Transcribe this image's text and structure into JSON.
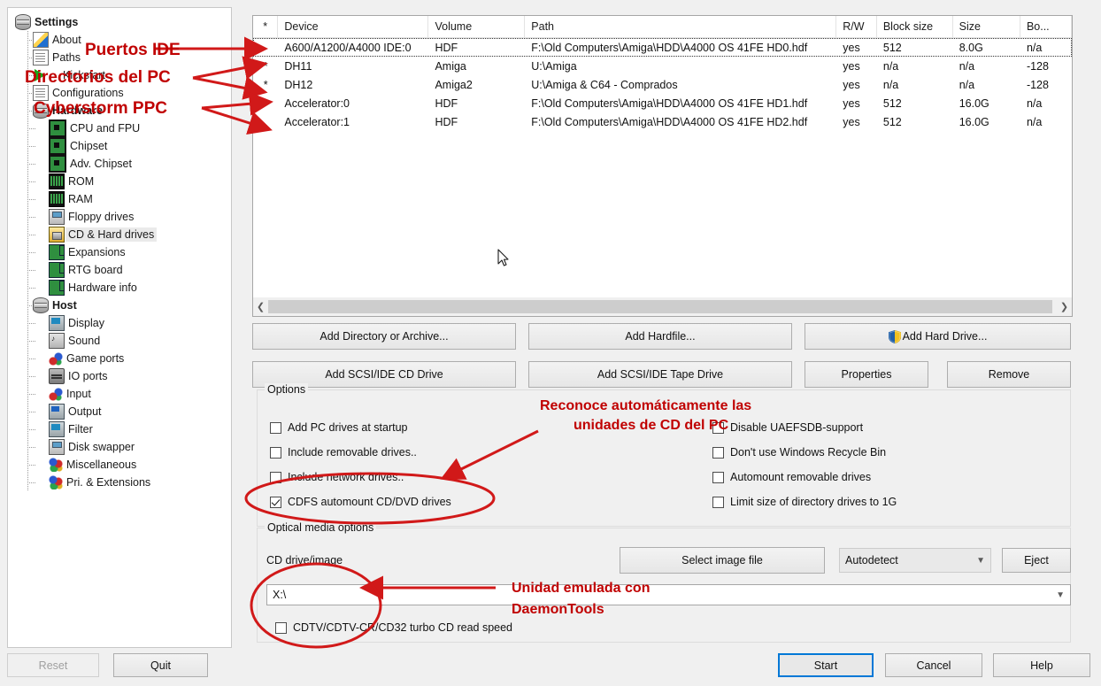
{
  "window": {
    "title": "Settings"
  },
  "sidebar": {
    "items": [
      {
        "label": "Settings",
        "icon": "stack-icon",
        "level": 0,
        "bold": true,
        "selected": false
      },
      {
        "label": "About",
        "icon": "pen-icon",
        "level": 1,
        "bold": false,
        "selected": false
      },
      {
        "label": "Paths",
        "icon": "doc-icon",
        "level": 1,
        "bold": false,
        "selected": false
      },
      {
        "label": "Kickstart",
        "icon": "play-icon",
        "level": 1,
        "bold": false,
        "selected": false
      },
      {
        "label": "Configurations",
        "icon": "doc-icon",
        "level": 1,
        "bold": false,
        "selected": false
      },
      {
        "label": "Hardware",
        "icon": "stack-icon",
        "level": 1,
        "bold": true,
        "selected": false
      },
      {
        "label": "CPU and FPU",
        "icon": "chip-icon",
        "level": 2,
        "bold": false,
        "selected": false
      },
      {
        "label": "Chipset",
        "icon": "chip-icon",
        "level": 2,
        "bold": false,
        "selected": false
      },
      {
        "label": "Adv. Chipset",
        "icon": "chip-icon",
        "level": 2,
        "bold": false,
        "selected": false
      },
      {
        "label": "ROM",
        "icon": "ram-icon",
        "level": 2,
        "bold": false,
        "selected": false
      },
      {
        "label": "RAM",
        "icon": "ram-icon",
        "level": 2,
        "bold": false,
        "selected": false
      },
      {
        "label": "Floppy drives",
        "icon": "floppy-icon",
        "level": 2,
        "bold": false,
        "selected": false
      },
      {
        "label": "CD & Hard drives",
        "icon": "cd-hdd-icon",
        "level": 2,
        "bold": false,
        "selected": true
      },
      {
        "label": "Expansions",
        "icon": "exp-card-icon",
        "level": 2,
        "bold": false,
        "selected": false
      },
      {
        "label": "RTG board",
        "icon": "exp-card-icon",
        "level": 2,
        "bold": false,
        "selected": false
      },
      {
        "label": "Hardware info",
        "icon": "exp-card-icon",
        "level": 2,
        "bold": false,
        "selected": false
      },
      {
        "label": "Host",
        "icon": "stack-icon",
        "level": 1,
        "bold": true,
        "selected": false
      },
      {
        "label": "Display",
        "icon": "monitor-icon",
        "level": 2,
        "bold": false,
        "selected": false
      },
      {
        "label": "Sound",
        "icon": "sound-icon",
        "level": 2,
        "bold": false,
        "selected": false
      },
      {
        "label": "Game ports",
        "icon": "joystick-icon",
        "level": 2,
        "bold": false,
        "selected": false
      },
      {
        "label": "IO ports",
        "icon": "io-icon",
        "level": 2,
        "bold": false,
        "selected": false
      },
      {
        "label": "Input",
        "icon": "joystick-icon",
        "level": 2,
        "bold": false,
        "selected": false
      },
      {
        "label": "Output",
        "icon": "output-icon",
        "level": 2,
        "bold": false,
        "selected": false
      },
      {
        "label": "Filter",
        "icon": "monitor-icon",
        "level": 2,
        "bold": false,
        "selected": false
      },
      {
        "label": "Disk swapper",
        "icon": "floppy-icon",
        "level": 2,
        "bold": false,
        "selected": false
      },
      {
        "label": "Miscellaneous",
        "icon": "balls-icon",
        "level": 2,
        "bold": false,
        "selected": false
      },
      {
        "label": "Pri. & Extensions",
        "icon": "balls-icon",
        "level": 2,
        "bold": false,
        "selected": false
      }
    ]
  },
  "drive_table": {
    "columns": [
      "*",
      "Device",
      "Volume",
      "Path",
      "R/W",
      "Block size",
      "Size",
      "Bo..."
    ],
    "rows": [
      {
        "star": "",
        "device": "A600/A1200/A4000 IDE:0",
        "volume": "HDF",
        "path": "F:\\Old Computers\\Amiga\\HDD\\A4000 OS 41FE HD0.hdf",
        "rw": "yes",
        "block": "512",
        "size": "8.0G",
        "bo": "n/a",
        "focused": true
      },
      {
        "star": "*",
        "device": "DH11",
        "volume": "Amiga",
        "path": "U:\\Amiga",
        "rw": "yes",
        "block": "n/a",
        "size": "n/a",
        "bo": "-128",
        "focused": false
      },
      {
        "star": "*",
        "device": "DH12",
        "volume": "Amiga2",
        "path": "U:\\Amiga & C64 - Comprados",
        "rw": "yes",
        "block": "n/a",
        "size": "n/a",
        "bo": "-128",
        "focused": false
      },
      {
        "star": "",
        "device": "Accelerator:0",
        "volume": "HDF",
        "path": "F:\\Old Computers\\Amiga\\HDD\\A4000 OS 41FE HD1.hdf",
        "rw": "yes",
        "block": "512",
        "size": "16.0G",
        "bo": "n/a",
        "focused": false
      },
      {
        "star": "",
        "device": "Accelerator:1",
        "volume": "HDF",
        "path": "F:\\Old Computers\\Amiga\\HDD\\A4000 OS 41FE HD2.hdf",
        "rw": "yes",
        "block": "512",
        "size": "16.0G",
        "bo": "n/a",
        "focused": false
      }
    ]
  },
  "action_buttons": {
    "add_directory": "Add Directory or Archive...",
    "add_hardfile": "Add Hardfile...",
    "add_hard_drive": "Add Hard Drive...",
    "add_cd_drive": "Add SCSI/IDE CD Drive",
    "add_tape_drive": "Add SCSI/IDE Tape Drive",
    "properties": "Properties",
    "remove": "Remove"
  },
  "options": {
    "title": "Options",
    "left": [
      {
        "label": "Add PC drives at startup",
        "checked": false
      },
      {
        "label": "Include removable drives..",
        "checked": false
      },
      {
        "label": "Include network drives..",
        "checked": false
      },
      {
        "label": "CDFS automount CD/DVD drives",
        "checked": true
      }
    ],
    "right": [
      {
        "label": "Disable UAEFSDB-support",
        "checked": false
      },
      {
        "label": "Don't use Windows Recycle Bin",
        "checked": false
      },
      {
        "label": "Automount removable drives",
        "checked": false
      },
      {
        "label": "Limit size of directory drives to 1G",
        "checked": false
      }
    ]
  },
  "optical": {
    "title": "Optical media options",
    "cd_label": "CD drive/image",
    "select_image_button": "Select image file",
    "mode_value": "Autodetect",
    "eject_button": "Eject",
    "drive_value": "X:\\",
    "turbo_checkbox": {
      "label": "CDTV/CDTV-CR/CD32 turbo CD read speed",
      "checked": false
    }
  },
  "footer": {
    "reset": "Reset",
    "quit": "Quit",
    "start": "Start",
    "cancel": "Cancel",
    "help": "Help"
  },
  "annotations": {
    "color": "#c00000",
    "notes": [
      {
        "id": "a1",
        "text": "Puertos IDE"
      },
      {
        "id": "a2",
        "text": "Directorios del PC"
      },
      {
        "id": "a3",
        "text": "Cyberstorm PPC"
      },
      {
        "id": "a4l1",
        "text": "Reconoce automáticamente las"
      },
      {
        "id": "a4l2",
        "text": "unidades de CD del PC"
      },
      {
        "id": "a5l1",
        "text": "Unidad emulada con"
      },
      {
        "id": "a5l2",
        "text": "DaemonTools"
      }
    ]
  }
}
